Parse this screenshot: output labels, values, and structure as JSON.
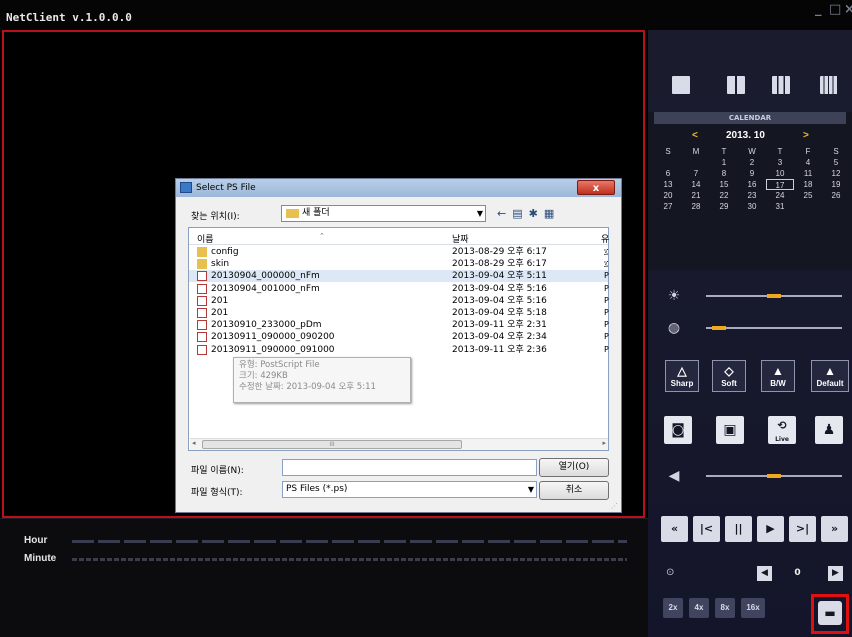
{
  "app": {
    "title": "NetClient v.1.0.0.0",
    "window_controls": [
      "_",
      "□",
      "×"
    ]
  },
  "timeline": {
    "hour_label": "Hour",
    "minute_label": "Minute"
  },
  "layout_buttons": [
    "single-view",
    "quad-view",
    "nine-view",
    "sixteen-view"
  ],
  "calendar": {
    "header": "CALENDAR",
    "month_label": "2013. 10",
    "prev_arrow": "<",
    "next_arrow": ">",
    "weekdays": [
      "S",
      "M",
      "T",
      "W",
      "T",
      "F",
      "S"
    ],
    "weeks": [
      [
        "",
        "",
        "1",
        "2",
        "3",
        "4",
        "5"
      ],
      [
        "6",
        "7",
        "8",
        "9",
        "10",
        "11",
        "12"
      ],
      [
        "13",
        "14",
        "15",
        "16",
        "17",
        "18",
        "19"
      ],
      [
        "20",
        "21",
        "22",
        "23",
        "24",
        "25",
        "26"
      ],
      [
        "27",
        "28",
        "29",
        "30",
        "31",
        "",
        ""
      ]
    ],
    "today": "17"
  },
  "sliders": {
    "brightness_level": 0.5,
    "contrast_level": 0.05,
    "volume_level": 0.5
  },
  "effects": {
    "sharp": "Sharp",
    "soft": "Soft",
    "bw": "B/W",
    "default": "Default"
  },
  "tools": {
    "live_label": "Live"
  },
  "playback": {
    "buttons": [
      "«",
      "|<",
      "||",
      "▶",
      ">|",
      "»"
    ],
    "frame_value": "0"
  },
  "speeds": [
    "2x",
    "4x",
    "8x",
    "16x"
  ],
  "dialog": {
    "title": "Select PS File",
    "close": "x",
    "lookin_label": "찾는 위치(I):",
    "lookin_value": "새 폴더",
    "col_name": "이름",
    "col_date": "날짜",
    "col_type": "유",
    "files": [
      {
        "name": "config",
        "date": "2013-08-29 오후 6:17",
        "type": "፲",
        "kind": "folder"
      },
      {
        "name": "skin",
        "date": "2013-08-29 오후 6:17",
        "type": "፲",
        "kind": "folder"
      },
      {
        "name": "20130904_000000_nFm",
        "date": "2013-09-04 오후 5:11",
        "type": "P",
        "kind": "ps"
      },
      {
        "name": "20130904_001000_nFm",
        "date": "2013-09-04 오후 5:16",
        "type": "P",
        "kind": "ps"
      },
      {
        "name": "201",
        "date": "2013-09-04 오후 5:16",
        "type": "P",
        "kind": "ps"
      },
      {
        "name": "201",
        "date": "2013-09-04 오후 5:18",
        "type": "P",
        "kind": "ps"
      },
      {
        "name": "20130910_233000_pDm",
        "date": "2013-09-11 오후 2:31",
        "type": "P",
        "kind": "ps"
      },
      {
        "name": "20130911_090000_090200",
        "date": "2013-09-04 오후 2:34",
        "type": "P",
        "kind": "ps"
      },
      {
        "name": "20130911_090000_091000",
        "date": "2013-09-11 오후 2:36",
        "type": "P",
        "kind": "ps"
      }
    ],
    "selected_index": 2,
    "tooltip": {
      "line1": "유형: PostScript File",
      "line2": "크기: 429KB",
      "line3": "수정한 날짜: 2013-09-04 오후 5:11"
    },
    "filename_label": "파일 이름(N):",
    "filename_value": "",
    "filetype_label": "파일 형식(T):",
    "filetype_value": "PS Files (*.ps)",
    "open_button": "열기(O)",
    "cancel_button": "취소"
  }
}
